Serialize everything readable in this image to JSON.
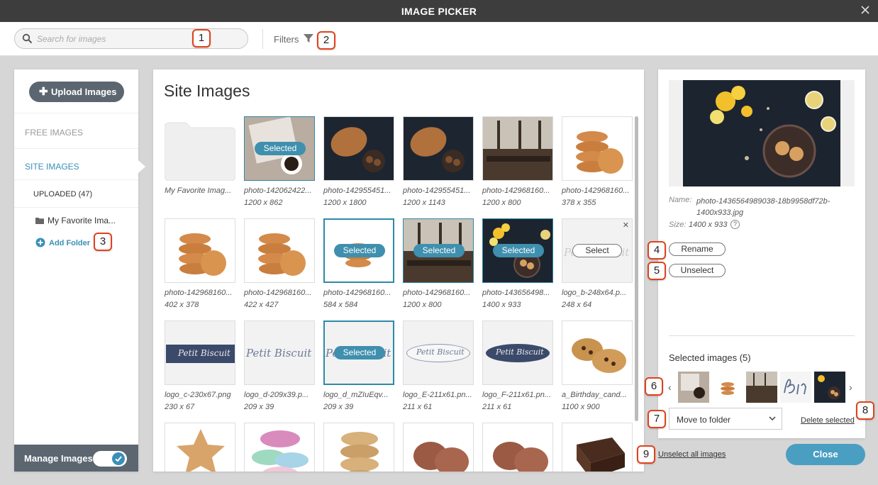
{
  "window": {
    "title": "IMAGE PICKER"
  },
  "search": {
    "placeholder": "Search for images"
  },
  "filters": {
    "label": "Filters"
  },
  "badges": [
    "1",
    "2",
    "3",
    "4",
    "5",
    "6",
    "7",
    "8",
    "9"
  ],
  "sidebar": {
    "upload_label": "Upload Images",
    "free_images": "FREE IMAGES",
    "site_images": "SITE IMAGES",
    "uploaded": "UPLOADED (47)",
    "folder": "My Favorite Ima...",
    "add_folder": "Add Folder",
    "manage_label": "Manage Images",
    "manage_toggle_on": true
  },
  "main": {
    "heading": "Site Images",
    "tiles": [
      {
        "name": "My Favorite Imag...",
        "size": "",
        "type": "folder"
      },
      {
        "name": "photo-142062422...",
        "size": "1200 x 862",
        "state": "Selected"
      },
      {
        "name": "photo-142955451...",
        "size": "1200 x 1800"
      },
      {
        "name": "photo-142955451...",
        "size": "1200 x 1143"
      },
      {
        "name": "photo-142968160...",
        "size": "1200 x 800"
      },
      {
        "name": "photo-142968160...",
        "size": "378 x 355"
      },
      {
        "name": "photo-142968160...",
        "size": "402 x 378"
      },
      {
        "name": "photo-142968160...",
        "size": "422 x 427"
      },
      {
        "name": "photo-142968160...",
        "size": "584 x 584",
        "state": "Selected"
      },
      {
        "name": "photo-142968160...",
        "size": "1200 x 800",
        "state": "Selected"
      },
      {
        "name": "photo-143656498...",
        "size": "1400 x 933",
        "state": "Selected"
      },
      {
        "name": "logo_b-248x64.p...",
        "size": "248 x 64",
        "state": "Select"
      },
      {
        "name": "logo_c-230x67.png",
        "size": "230 x 67"
      },
      {
        "name": "logo_d-209x39.p...",
        "size": "209 x 39"
      },
      {
        "name": "logo_d_mZIuEqv...",
        "size": "209 x 39",
        "state": "Selected"
      },
      {
        "name": "logo_E-211x61.pn...",
        "size": "211 x 61"
      },
      {
        "name": "logo_F-211x61.pn...",
        "size": "211 x 61"
      },
      {
        "name": "a_Birthday_cand...",
        "size": "1100 x 900"
      },
      {
        "name": "",
        "size": ""
      },
      {
        "name": "",
        "size": ""
      },
      {
        "name": "",
        "size": ""
      },
      {
        "name": "",
        "size": ""
      },
      {
        "name": "",
        "size": ""
      },
      {
        "name": "",
        "size": ""
      }
    ],
    "logo_text": "Petit Biscuit"
  },
  "details": {
    "name_label": "Name:",
    "name_value": "photo-1436564989038-18b9958df72b-1400x933.jpg",
    "size_label": "Size:",
    "size_value": "1400 x 933",
    "help_glyph": "?",
    "rename_label": "Rename",
    "unselect_label": "Unselect",
    "selected_heading": "Selected images (5)",
    "move_folder_label": "Move to folder",
    "delete_selected_label": "Delete selected"
  },
  "footer": {
    "unselect_all_label": "Unselect all images",
    "close_label": "Close"
  },
  "selected_pill_label": "Selected",
  "select_pill_label": "Select",
  "colors": {
    "titlebar": "#3d3d3d",
    "accent": "#3f8fae",
    "badge_border": "#e0421d",
    "sidebar_dark": "#5b6670"
  }
}
